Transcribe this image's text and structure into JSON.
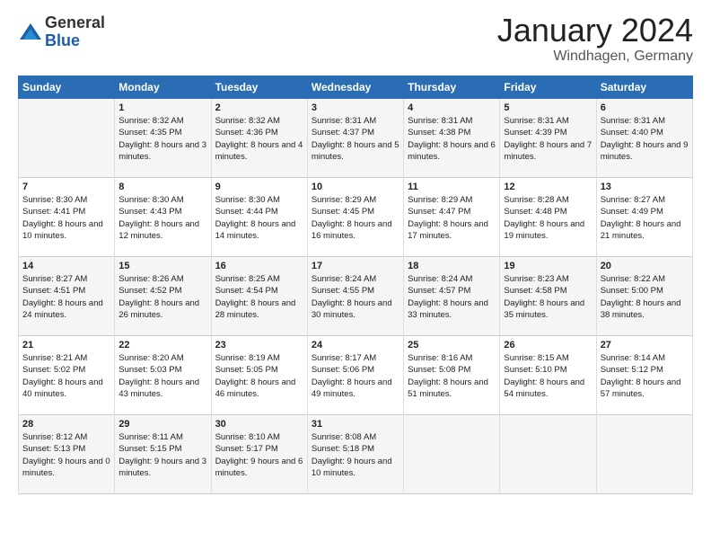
{
  "header": {
    "logo_general": "General",
    "logo_blue": "Blue",
    "month_title": "January 2024",
    "location": "Windhagen, Germany"
  },
  "days_of_week": [
    "Sunday",
    "Monday",
    "Tuesday",
    "Wednesday",
    "Thursday",
    "Friday",
    "Saturday"
  ],
  "weeks": [
    [
      {
        "num": "",
        "sunrise": "",
        "sunset": "",
        "daylight": ""
      },
      {
        "num": "1",
        "sunrise": "Sunrise: 8:32 AM",
        "sunset": "Sunset: 4:35 PM",
        "daylight": "Daylight: 8 hours and 3 minutes."
      },
      {
        "num": "2",
        "sunrise": "Sunrise: 8:32 AM",
        "sunset": "Sunset: 4:36 PM",
        "daylight": "Daylight: 8 hours and 4 minutes."
      },
      {
        "num": "3",
        "sunrise": "Sunrise: 8:31 AM",
        "sunset": "Sunset: 4:37 PM",
        "daylight": "Daylight: 8 hours and 5 minutes."
      },
      {
        "num": "4",
        "sunrise": "Sunrise: 8:31 AM",
        "sunset": "Sunset: 4:38 PM",
        "daylight": "Daylight: 8 hours and 6 minutes."
      },
      {
        "num": "5",
        "sunrise": "Sunrise: 8:31 AM",
        "sunset": "Sunset: 4:39 PM",
        "daylight": "Daylight: 8 hours and 7 minutes."
      },
      {
        "num": "6",
        "sunrise": "Sunrise: 8:31 AM",
        "sunset": "Sunset: 4:40 PM",
        "daylight": "Daylight: 8 hours and 9 minutes."
      }
    ],
    [
      {
        "num": "7",
        "sunrise": "Sunrise: 8:30 AM",
        "sunset": "Sunset: 4:41 PM",
        "daylight": "Daylight: 8 hours and 10 minutes."
      },
      {
        "num": "8",
        "sunrise": "Sunrise: 8:30 AM",
        "sunset": "Sunset: 4:43 PM",
        "daylight": "Daylight: 8 hours and 12 minutes."
      },
      {
        "num": "9",
        "sunrise": "Sunrise: 8:30 AM",
        "sunset": "Sunset: 4:44 PM",
        "daylight": "Daylight: 8 hours and 14 minutes."
      },
      {
        "num": "10",
        "sunrise": "Sunrise: 8:29 AM",
        "sunset": "Sunset: 4:45 PM",
        "daylight": "Daylight: 8 hours and 16 minutes."
      },
      {
        "num": "11",
        "sunrise": "Sunrise: 8:29 AM",
        "sunset": "Sunset: 4:47 PM",
        "daylight": "Daylight: 8 hours and 17 minutes."
      },
      {
        "num": "12",
        "sunrise": "Sunrise: 8:28 AM",
        "sunset": "Sunset: 4:48 PM",
        "daylight": "Daylight: 8 hours and 19 minutes."
      },
      {
        "num": "13",
        "sunrise": "Sunrise: 8:27 AM",
        "sunset": "Sunset: 4:49 PM",
        "daylight": "Daylight: 8 hours and 21 minutes."
      }
    ],
    [
      {
        "num": "14",
        "sunrise": "Sunrise: 8:27 AM",
        "sunset": "Sunset: 4:51 PM",
        "daylight": "Daylight: 8 hours and 24 minutes."
      },
      {
        "num": "15",
        "sunrise": "Sunrise: 8:26 AM",
        "sunset": "Sunset: 4:52 PM",
        "daylight": "Daylight: 8 hours and 26 minutes."
      },
      {
        "num": "16",
        "sunrise": "Sunrise: 8:25 AM",
        "sunset": "Sunset: 4:54 PM",
        "daylight": "Daylight: 8 hours and 28 minutes."
      },
      {
        "num": "17",
        "sunrise": "Sunrise: 8:24 AM",
        "sunset": "Sunset: 4:55 PM",
        "daylight": "Daylight: 8 hours and 30 minutes."
      },
      {
        "num": "18",
        "sunrise": "Sunrise: 8:24 AM",
        "sunset": "Sunset: 4:57 PM",
        "daylight": "Daylight: 8 hours and 33 minutes."
      },
      {
        "num": "19",
        "sunrise": "Sunrise: 8:23 AM",
        "sunset": "Sunset: 4:58 PM",
        "daylight": "Daylight: 8 hours and 35 minutes."
      },
      {
        "num": "20",
        "sunrise": "Sunrise: 8:22 AM",
        "sunset": "Sunset: 5:00 PM",
        "daylight": "Daylight: 8 hours and 38 minutes."
      }
    ],
    [
      {
        "num": "21",
        "sunrise": "Sunrise: 8:21 AM",
        "sunset": "Sunset: 5:02 PM",
        "daylight": "Daylight: 8 hours and 40 minutes."
      },
      {
        "num": "22",
        "sunrise": "Sunrise: 8:20 AM",
        "sunset": "Sunset: 5:03 PM",
        "daylight": "Daylight: 8 hours and 43 minutes."
      },
      {
        "num": "23",
        "sunrise": "Sunrise: 8:19 AM",
        "sunset": "Sunset: 5:05 PM",
        "daylight": "Daylight: 8 hours and 46 minutes."
      },
      {
        "num": "24",
        "sunrise": "Sunrise: 8:17 AM",
        "sunset": "Sunset: 5:06 PM",
        "daylight": "Daylight: 8 hours and 49 minutes."
      },
      {
        "num": "25",
        "sunrise": "Sunrise: 8:16 AM",
        "sunset": "Sunset: 5:08 PM",
        "daylight": "Daylight: 8 hours and 51 minutes."
      },
      {
        "num": "26",
        "sunrise": "Sunrise: 8:15 AM",
        "sunset": "Sunset: 5:10 PM",
        "daylight": "Daylight: 8 hours and 54 minutes."
      },
      {
        "num": "27",
        "sunrise": "Sunrise: 8:14 AM",
        "sunset": "Sunset: 5:12 PM",
        "daylight": "Daylight: 8 hours and 57 minutes."
      }
    ],
    [
      {
        "num": "28",
        "sunrise": "Sunrise: 8:12 AM",
        "sunset": "Sunset: 5:13 PM",
        "daylight": "Daylight: 9 hours and 0 minutes."
      },
      {
        "num": "29",
        "sunrise": "Sunrise: 8:11 AM",
        "sunset": "Sunset: 5:15 PM",
        "daylight": "Daylight: 9 hours and 3 minutes."
      },
      {
        "num": "30",
        "sunrise": "Sunrise: 8:10 AM",
        "sunset": "Sunset: 5:17 PM",
        "daylight": "Daylight: 9 hours and 6 minutes."
      },
      {
        "num": "31",
        "sunrise": "Sunrise: 8:08 AM",
        "sunset": "Sunset: 5:18 PM",
        "daylight": "Daylight: 9 hours and 10 minutes."
      },
      {
        "num": "",
        "sunrise": "",
        "sunset": "",
        "daylight": ""
      },
      {
        "num": "",
        "sunrise": "",
        "sunset": "",
        "daylight": ""
      },
      {
        "num": "",
        "sunrise": "",
        "sunset": "",
        "daylight": ""
      }
    ]
  ]
}
